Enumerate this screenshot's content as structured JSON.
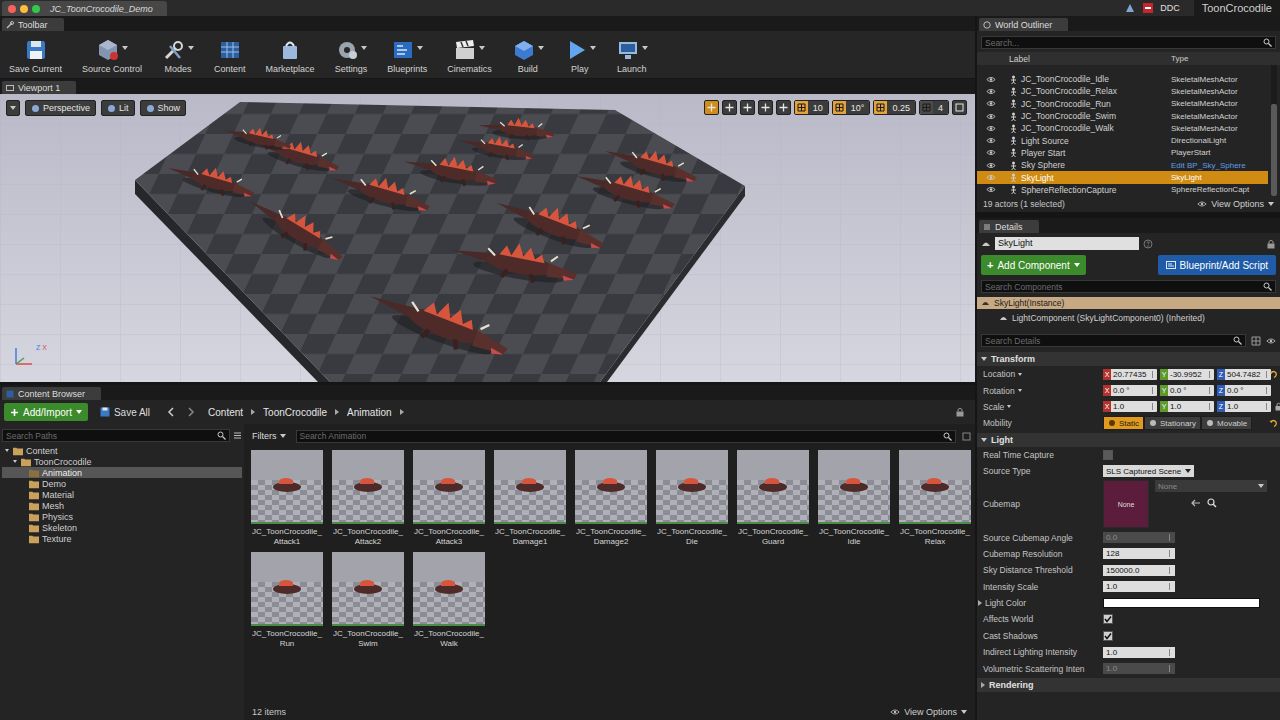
{
  "window": {
    "tab_title": "JC_ToonCrocodile_Demo",
    "traffic_lights": [
      {
        "color": "#fc605c"
      },
      {
        "color": "#fdbc40"
      },
      {
        "color": "#34c84a"
      }
    ],
    "ddc": "DDC",
    "project": "ToonCrocodile"
  },
  "toolbar": {
    "header": "Toolbar",
    "buttons": [
      {
        "label": "Save Current",
        "dropdown": false
      },
      {
        "label": "Source Control",
        "dropdown": true
      },
      {
        "label": "Modes",
        "dropdown": true
      },
      {
        "label": "Content",
        "dropdown": false
      },
      {
        "label": "Marketplace",
        "dropdown": false
      },
      {
        "label": "Settings",
        "dropdown": true
      },
      {
        "label": "Blueprints",
        "dropdown": true
      },
      {
        "label": "Cinematics",
        "dropdown": true
      },
      {
        "label": "Build",
        "dropdown": true
      },
      {
        "label": "Play",
        "dropdown": true
      },
      {
        "label": "Launch",
        "dropdown": true
      }
    ]
  },
  "viewport": {
    "header": "Viewport 1",
    "view_buttons": [
      "Perspective",
      "Lit",
      "Show"
    ],
    "transform_tools": [
      {
        "selected": true
      },
      {
        "selected": false
      },
      {
        "selected": false
      },
      {
        "selected": false
      },
      {
        "selected": false
      }
    ],
    "snaps": [
      {
        "value": "10",
        "active": true
      },
      {
        "value": "10°",
        "active": true
      },
      {
        "value": "0.25",
        "active": true
      },
      {
        "value": "4",
        "active": false
      }
    ],
    "gizmo_axes": [
      {
        "label": "Z",
        "color": "#4a78e0"
      },
      {
        "label": "X",
        "color": "#e04a4a"
      }
    ]
  },
  "content_browser": {
    "header": "Content Browser",
    "add_button": "Add/Import",
    "save_all": "Save All",
    "breadcrumb": [
      "Content",
      "ToonCrocodile",
      "Animation"
    ],
    "path_search": {
      "placeholder": "Search Paths"
    },
    "tree": [
      {
        "label": "Content",
        "depth": 0,
        "expanded": true,
        "selected": false
      },
      {
        "label": "ToonCrocodile",
        "depth": 1,
        "expanded": true,
        "selected": false
      },
      {
        "label": "Animation",
        "depth": 2,
        "expanded": false,
        "selected": true
      },
      {
        "label": "Demo",
        "depth": 2,
        "expanded": false,
        "selected": false
      },
      {
        "label": "Material",
        "depth": 2,
        "expanded": false,
        "selected": false
      },
      {
        "label": "Mesh",
        "depth": 2,
        "expanded": false,
        "selected": false
      },
      {
        "label": "Physics",
        "depth": 2,
        "expanded": false,
        "selected": false
      },
      {
        "label": "Skeleton",
        "depth": 2,
        "expanded": false,
        "selected": false
      },
      {
        "label": "Texture",
        "depth": 2,
        "expanded": false,
        "selected": false
      }
    ],
    "filters": "Filters",
    "asset_search": {
      "placeholder": "Search Animation"
    },
    "assets": [
      {
        "name_lines": [
          "JC_ToonCrocodile_",
          "Attack1"
        ]
      },
      {
        "name_lines": [
          "JC_ToonCrocodile_",
          "Attack2"
        ]
      },
      {
        "name_lines": [
          "JC_ToonCrocodile_",
          "Attack3"
        ]
      },
      {
        "name_lines": [
          "JC_ToonCrocodile_",
          "Damage1"
        ]
      },
      {
        "name_lines": [
          "JC_ToonCrocodile_",
          "Damage2"
        ]
      },
      {
        "name_lines": [
          "JC_ToonCrocodile_",
          "Die"
        ]
      },
      {
        "name_lines": [
          "JC_ToonCrocodile_",
          "Guard"
        ]
      },
      {
        "name_lines": [
          "JC_ToonCrocodile_",
          "Idle"
        ]
      },
      {
        "name_lines": [
          "JC_ToonCrocodile_",
          "Relax"
        ]
      },
      {
        "name_lines": [
          "JC_ToonCrocodile_",
          "Run"
        ]
      },
      {
        "name_lines": [
          "JC_ToonCrocodile_",
          "Swim"
        ]
      },
      {
        "name_lines": [
          "JC_ToonCrocodile_",
          "Walk"
        ]
      }
    ],
    "item_count": "12 items",
    "view_options": "View Options"
  },
  "world_outliner": {
    "header": "World Outliner",
    "search": {
      "placeholder": "Search..."
    },
    "columns": [
      "Label",
      "Type"
    ],
    "rows": [
      {
        "label": "JC_ToonCrocodile_Idle",
        "type": "SkeletalMeshActor",
        "link": false,
        "selected": false,
        "visible": true
      },
      {
        "label": "JC_ToonCrocodile_Relax",
        "type": "SkeletalMeshActor",
        "link": false,
        "selected": false,
        "visible": true
      },
      {
        "label": "JC_ToonCrocodile_Run",
        "type": "SkeletalMeshActor",
        "link": false,
        "selected": false,
        "visible": true
      },
      {
        "label": "JC_ToonCrocodile_Swim",
        "type": "SkeletalMeshActor",
        "link": false,
        "selected": false,
        "visible": true
      },
      {
        "label": "JC_ToonCrocodile_Walk",
        "type": "SkeletalMeshActor",
        "link": false,
        "selected": false,
        "visible": true
      },
      {
        "label": "Light Source",
        "type": "DirectionalLight",
        "link": false,
        "selected": false,
        "visible": true
      },
      {
        "label": "Player Start",
        "type": "PlayerStart",
        "link": false,
        "selected": false,
        "visible": true
      },
      {
        "label": "Sky Sphere",
        "type": "Edit BP_Sky_Sphere",
        "link": true,
        "selected": false,
        "visible": true
      },
      {
        "label": "SkyLight",
        "type": "SkyLight",
        "link": false,
        "selected": true,
        "visible": true
      },
      {
        "label": "SphereReflectionCapture",
        "type": "SphereReflectionCapt",
        "link": false,
        "selected": false,
        "visible": true
      }
    ],
    "status": "19 actors (1 selected)",
    "view_options": "View Options"
  },
  "details": {
    "header": "Details",
    "name": "SkyLight",
    "add_component": {
      "icon": "+",
      "label": "Add Component"
    },
    "blueprint_button": "Blueprint/Add Script",
    "component_search": {
      "placeholder": "Search Components"
    },
    "components": [
      {
        "label": "SkyLight(Instance)",
        "depth": 0,
        "selected": true
      },
      {
        "label": "LightComponent (SkyLightComponent0) (Inherited)",
        "depth": 1,
        "selected": false
      }
    ],
    "details_search": {
      "placeholder": "Search Details"
    },
    "sections": [
      {
        "title": "Transform",
        "expanded": true,
        "rows": [
          {
            "kind": "vector",
            "label": "Location",
            "dropdown": true,
            "lock": false,
            "reset": true,
            "values": [
              {
                "axis": "X",
                "value": "20.77435",
                "color": "#b3322b"
              },
              {
                "axis": "Y",
                "value": "-30.9952",
                "color": "#5b9a2b"
              },
              {
                "axis": "Z",
                "value": "504.7482",
                "color": "#2e5cb8"
              }
            ]
          },
          {
            "kind": "vector",
            "label": "Rotation",
            "dropdown": true,
            "lock": false,
            "reset": false,
            "values": [
              {
                "axis": "X",
                "value": "0.0 °",
                "color": "#b3322b"
              },
              {
                "axis": "Y",
                "value": "0.0 °",
                "color": "#5b9a2b"
              },
              {
                "axis": "Z",
                "value": "0.0 °",
                "color": "#2e5cb8"
              }
            ]
          },
          {
            "kind": "vector",
            "label": "Scale",
            "dropdown": true,
            "lock": true,
            "reset": false,
            "values": [
              {
                "axis": "X",
                "value": "1.0",
                "color": "#b3322b"
              },
              {
                "axis": "Y",
                "value": "1.0",
                "color": "#5b9a2b"
              },
              {
                "axis": "Z",
                "value": "1.0",
                "color": "#2e5cb8"
              }
            ]
          },
          {
            "kind": "mobility",
            "label": "Mobility",
            "reset": true,
            "options": [
              {
                "label": "Static",
                "selected": true
              },
              {
                "label": "Stationary",
                "selected": false
              },
              {
                "label": "Movable",
                "selected": false
              }
            ]
          }
        ]
      },
      {
        "title": "Light",
        "expanded": true,
        "rows": [
          {
            "kind": "checkbox",
            "label": "Real Time Capture",
            "checked": false
          },
          {
            "kind": "dropdown",
            "label": "Source Type",
            "value": "SLS Captured Scene"
          },
          {
            "kind": "cubemap",
            "label": "Cubemap",
            "thumb": "None",
            "value": "None"
          },
          {
            "kind": "number",
            "label": "Source Cubemap Angle",
            "value": "0.0",
            "disabled": true
          },
          {
            "kind": "number",
            "label": "Cubemap Resolution",
            "value": "128",
            "disabled": false
          },
          {
            "kind": "number",
            "label": "Sky Distance Threshold",
            "value": "150000.0",
            "disabled": false
          },
          {
            "kind": "number",
            "label": "Intensity Scale",
            "value": "1.0",
            "disabled": false
          },
          {
            "kind": "color",
            "label": "Light Color",
            "color": "#ffffff",
            "expandable": true
          },
          {
            "kind": "checkbox",
            "label": "Affects World",
            "checked": true
          },
          {
            "kind": "checkbox",
            "label": "Cast Shadows",
            "checked": true
          },
          {
            "kind": "number",
            "label": "Indirect Lighting Intensity",
            "value": "1.0",
            "disabled": false
          },
          {
            "kind": "number",
            "label": "Volumetric Scattering Inten",
            "value": "1.0",
            "disabled": true
          }
        ]
      },
      {
        "title": "Rendering",
        "expanded": false,
        "rows": []
      }
    ]
  }
}
